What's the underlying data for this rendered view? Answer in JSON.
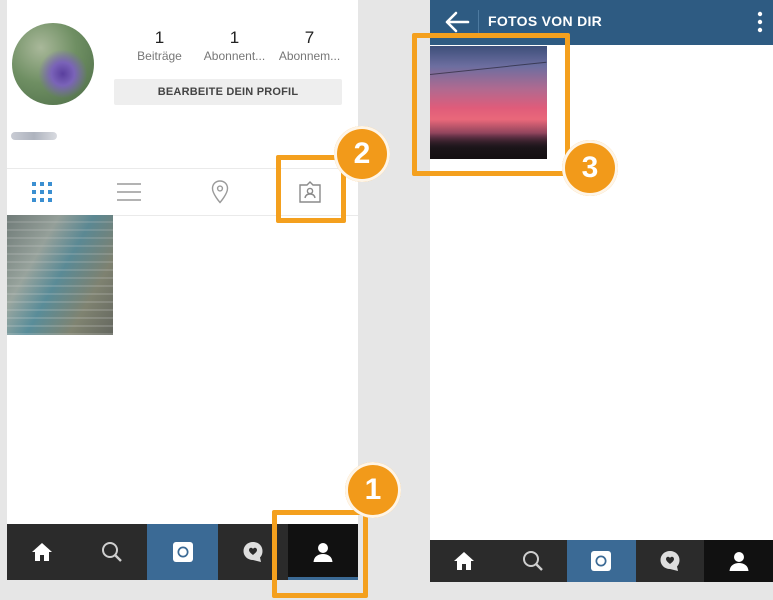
{
  "colors": {
    "accent": "#f4a01e",
    "header_blue": "#2e5b82",
    "nav_dark": "#2b2b2b",
    "nav_active": "#111111",
    "camera_blue": "#3b6a95"
  },
  "profile": {
    "stats": [
      {
        "value": "1",
        "label": "Beiträge"
      },
      {
        "value": "1",
        "label": "Abonnent..."
      },
      {
        "value": "7",
        "label": "Abonnem..."
      }
    ],
    "edit_button": "BEARBEITE DEIN PROFIL",
    "tabs": [
      {
        "icon": "grid-icon",
        "active": true
      },
      {
        "icon": "list-icon",
        "active": false
      },
      {
        "icon": "location-pin-icon",
        "active": false
      },
      {
        "icon": "tagged-photos-icon",
        "active": false
      }
    ]
  },
  "photos_of_you": {
    "title": "FOTOS VON DIR"
  },
  "bottom_nav": [
    "home-icon",
    "search-icon",
    "camera-icon",
    "heart-bubble-icon",
    "profile-icon"
  ],
  "annotations": [
    {
      "number": "1",
      "target": "profile tab in bottom navigation"
    },
    {
      "number": "2",
      "target": "tagged photos tab"
    },
    {
      "number": "3",
      "target": "tagged photo"
    }
  ]
}
